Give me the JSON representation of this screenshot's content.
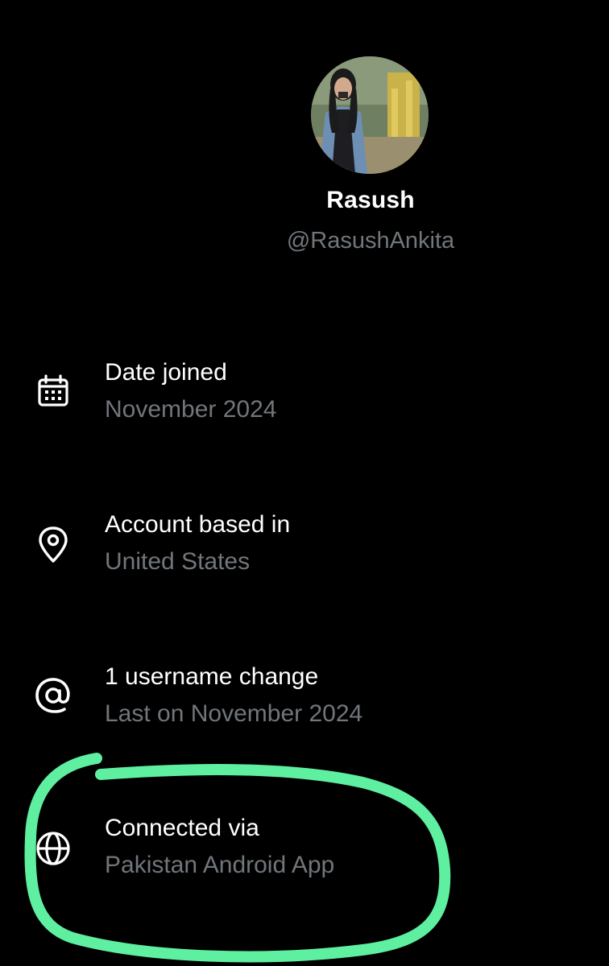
{
  "profile": {
    "display_name": "Rasush",
    "handle": "@RasushAnkita"
  },
  "info": {
    "date_joined": {
      "icon": "calendar-icon",
      "title": "Date joined",
      "value": "November 2024"
    },
    "account_based_in": {
      "icon": "location-pin-icon",
      "title": "Account based in",
      "value": "United States"
    },
    "username_changes": {
      "icon": "at-sign-icon",
      "title": "1 username change",
      "value": "Last on November 2024"
    },
    "connected_via": {
      "icon": "globe-icon",
      "title": "Connected via",
      "value": "Pakistan Android App"
    }
  },
  "colors": {
    "background": "#000000",
    "primary_text": "#ffffff",
    "secondary_text": "#71767b",
    "highlight_marker": "#5ef0a0"
  }
}
